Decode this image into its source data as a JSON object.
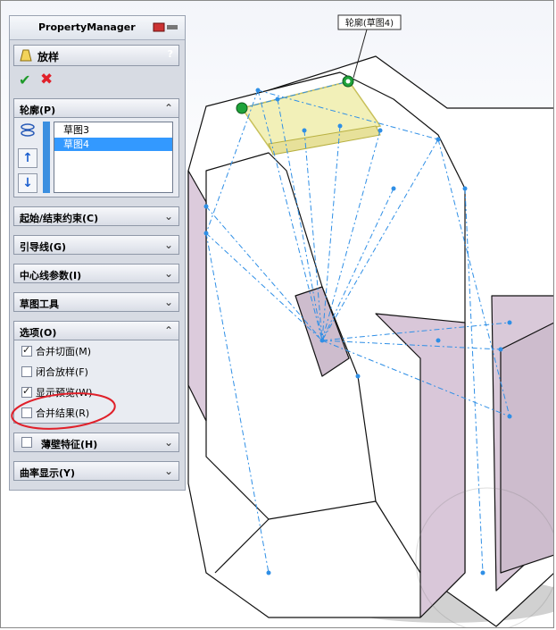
{
  "panel": {
    "title": "PropertyManager",
    "feature_title": "放样",
    "help": "?",
    "ok_icon": "check-icon",
    "cancel_icon": "x-icon"
  },
  "profiles": {
    "label": "轮廓(P)",
    "items": [
      "草图3",
      "草图4"
    ],
    "selected_index": 1
  },
  "sections": {
    "start_end": "起始/结束约束(C)",
    "guides": "引导线(G)",
    "centerline": "中心线参数(I)",
    "sketch_tools": "草图工具",
    "options": "选项(O)",
    "thin": "薄壁特征(H)",
    "curvature": "曲率显示(Y)"
  },
  "options": [
    {
      "label": "合并切面(M)",
      "checked": true
    },
    {
      "label": "闭合放样(F)",
      "checked": false
    },
    {
      "label": "显示预览(W)",
      "checked": true
    },
    {
      "label": "合并结果(R)",
      "checked": false
    }
  ],
  "callout": "轮廓(草图4)",
  "colors": {
    "accent_red": "#e0202a",
    "selection_blue": "#3399ff",
    "preview_blue": "#2f8fe6",
    "handle_green": "#1fa33a",
    "side_purple": "#d9c9d9"
  }
}
